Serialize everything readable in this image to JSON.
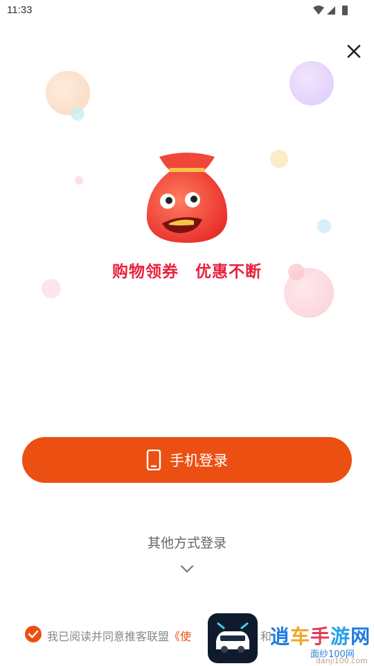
{
  "status_bar": {
    "time": "11:33",
    "icons": [
      "wifi-icon",
      "signal-icon",
      "battery-icon"
    ]
  },
  "close": {
    "icon": "close-icon"
  },
  "promo": {
    "slogan_left": "购物领券",
    "slogan_right": "优惠不断",
    "mascot": "red-lucky-bag-mascot"
  },
  "login": {
    "phone_button_label": "手机登录",
    "phone_icon": "phone-icon",
    "other_methods_label": "其他方式登录",
    "expand_icon": "chevron-down-icon"
  },
  "agreement": {
    "checked": true,
    "text": "我已阅读并同意推客联盟",
    "link_fragment": "《使",
    "conjunction": "和"
  },
  "watermark": {
    "chars": [
      "逍",
      "车",
      "手",
      "游",
      "网"
    ],
    "sub_text": "面纱100网",
    "url": "danji100.com"
  },
  "colors": {
    "accent": "#ec4f12",
    "slogan": "#e8213b"
  }
}
